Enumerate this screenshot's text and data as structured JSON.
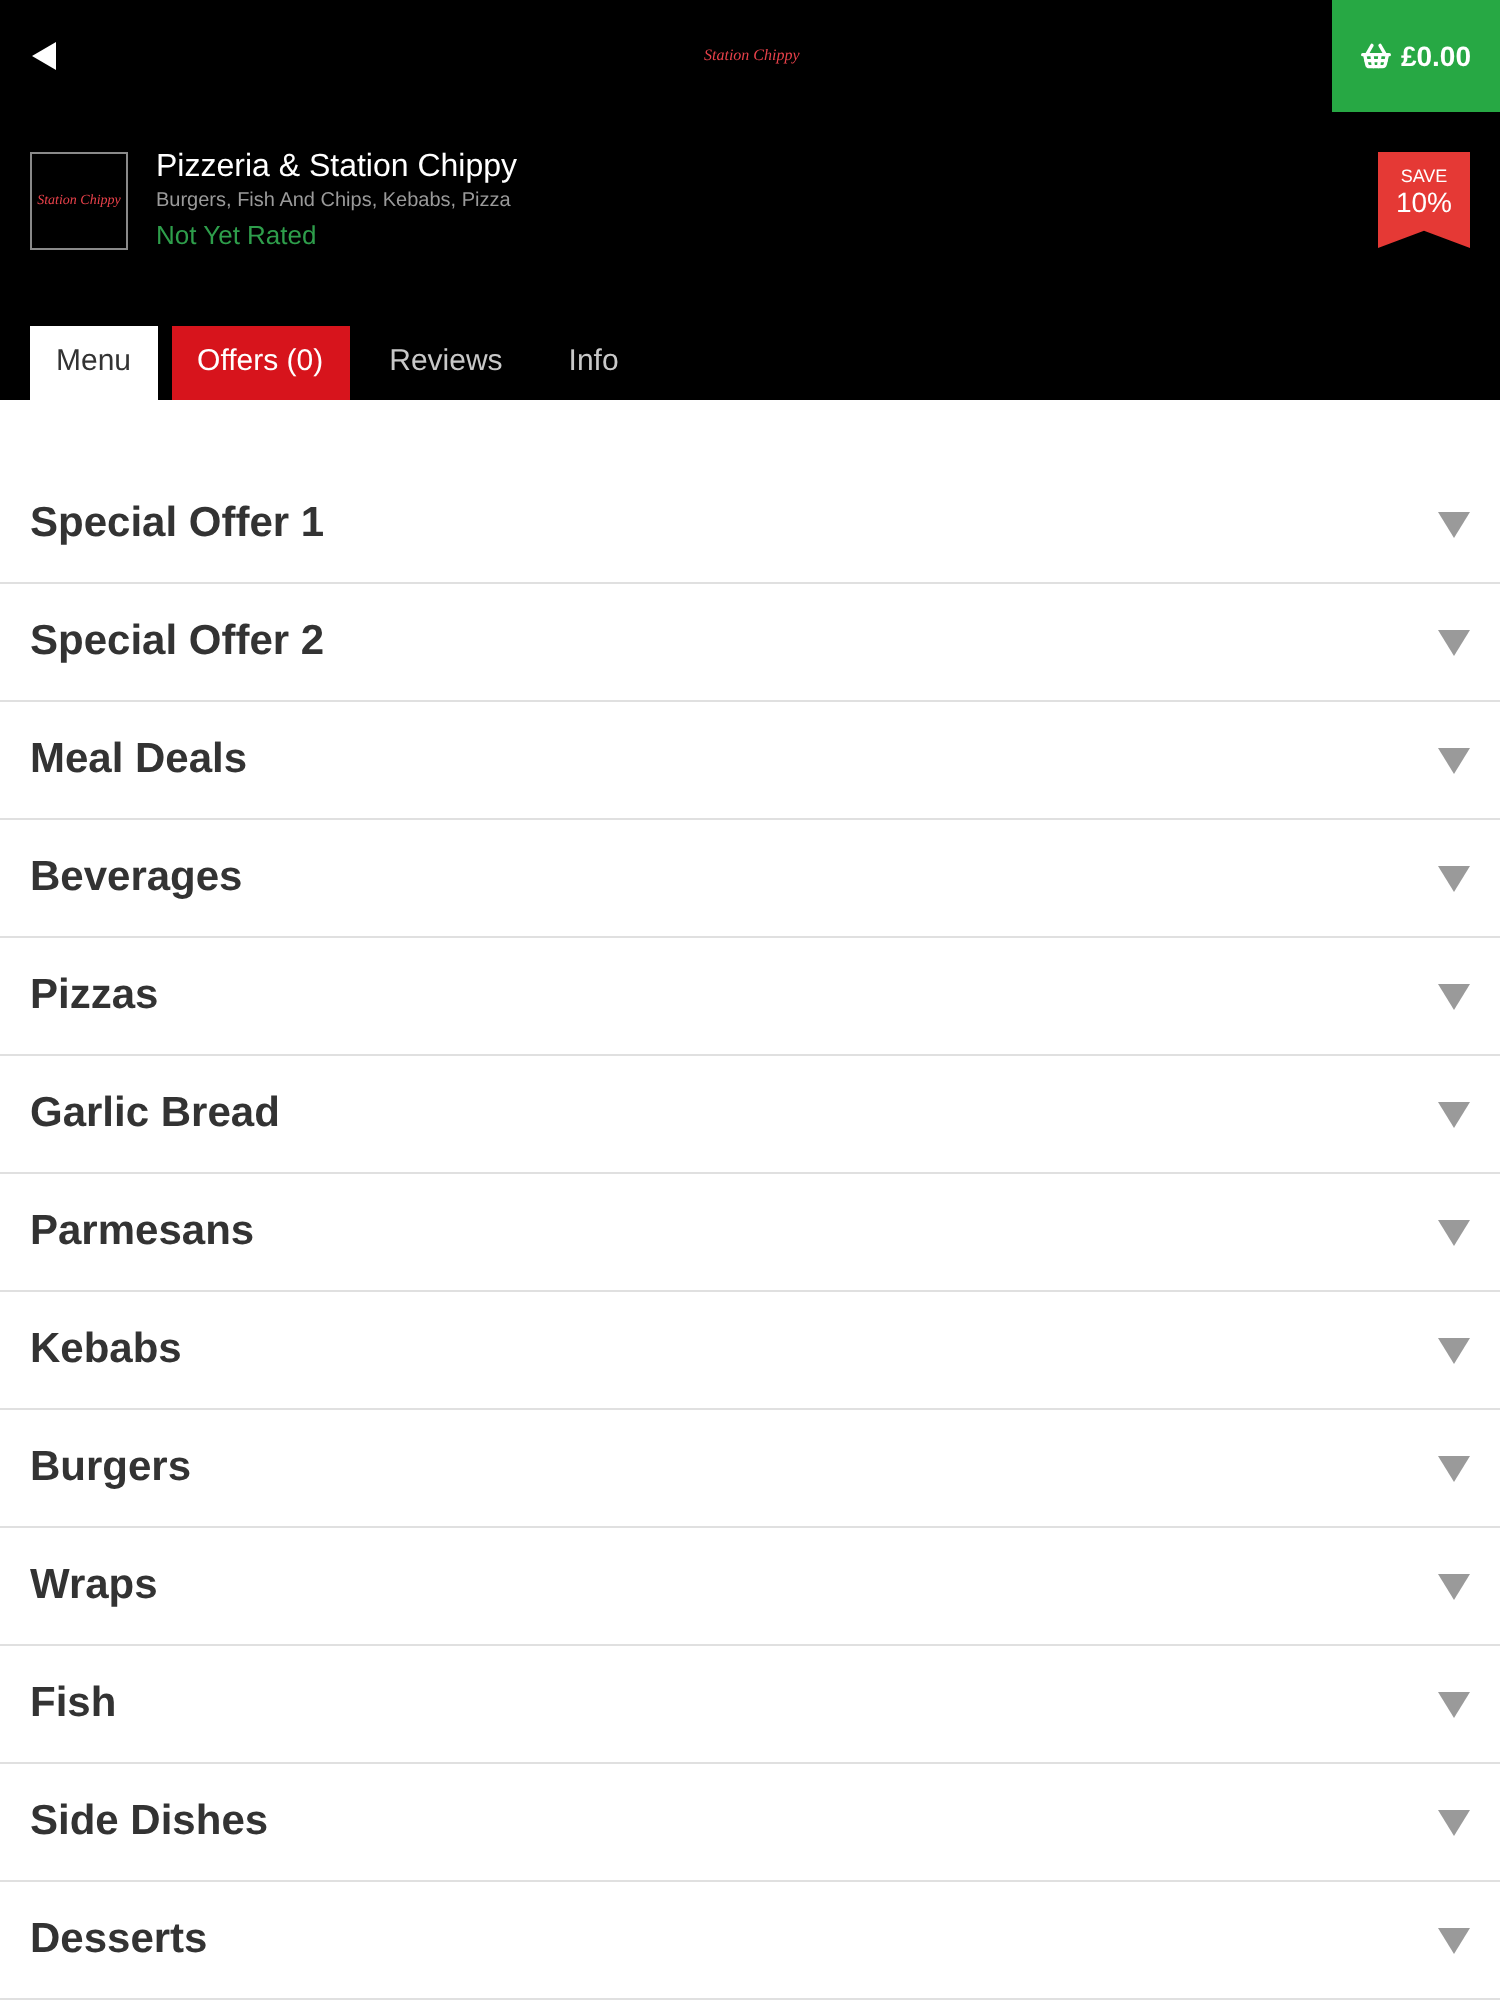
{
  "top_bar": {
    "logo_text": "Station Chippy",
    "basket_total": "£0.00"
  },
  "restaurant": {
    "logo_text": "Station Chippy",
    "name": "Pizzeria & Station Chippy",
    "cuisines": "Burgers, Fish And Chips, Kebabs, Pizza",
    "rating": "Not Yet Rated"
  },
  "badge": {
    "label": "SAVE",
    "value": "10%"
  },
  "tabs": [
    {
      "label": "Menu",
      "selected": true,
      "highlighted": false
    },
    {
      "label": "Offers (0)",
      "selected": false,
      "highlighted": true
    },
    {
      "label": "Reviews",
      "selected": false,
      "highlighted": false
    },
    {
      "label": "Info",
      "selected": false,
      "highlighted": false
    }
  ],
  "categories": [
    {
      "name": "Special Offer 1",
      "expanded": false
    },
    {
      "name": "Special Offer 2",
      "expanded": false
    },
    {
      "name": "Meal Deals",
      "expanded": false
    },
    {
      "name": "Beverages",
      "expanded": false
    },
    {
      "name": "Pizzas",
      "expanded": false
    },
    {
      "name": "Garlic Bread",
      "expanded": false
    },
    {
      "name": "Parmesans",
      "expanded": false
    },
    {
      "name": "Kebabs",
      "expanded": false
    },
    {
      "name": "Burgers",
      "expanded": false
    },
    {
      "name": "Wraps",
      "expanded": false
    },
    {
      "name": "Fish",
      "expanded": false
    },
    {
      "name": "Side Dishes",
      "expanded": false
    },
    {
      "name": "Desserts",
      "expanded": false
    }
  ]
}
